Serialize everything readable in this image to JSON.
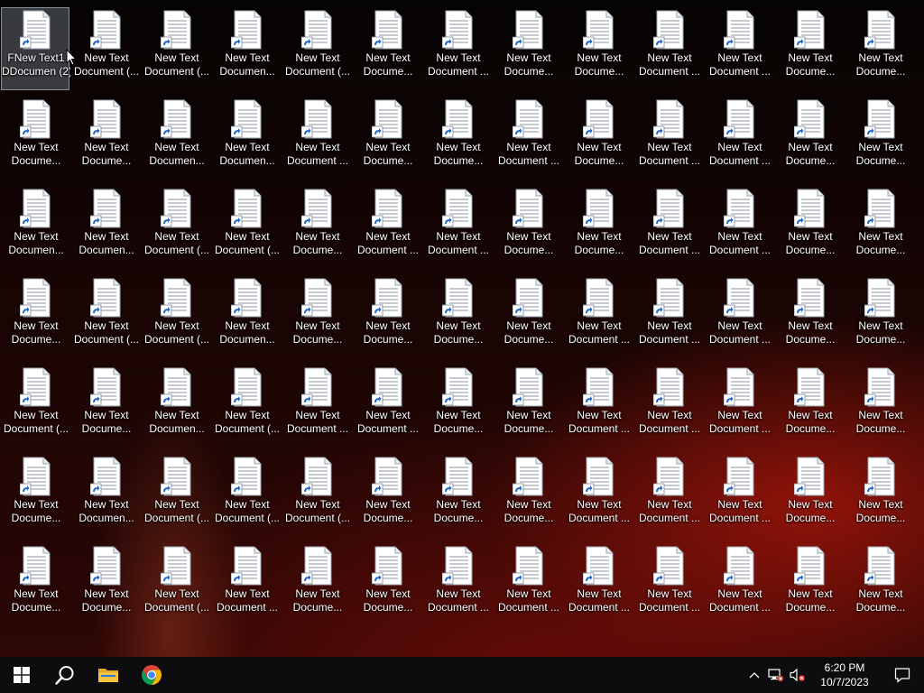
{
  "desktop": {
    "icon_rows": [
      [
        {
          "line1": "FNew Text1",
          "line2": "DDocumen (2)",
          "selected": true
        },
        {
          "line1": "New Text",
          "line2": "Document (..."
        },
        {
          "line1": "New Text",
          "line2": "Document (..."
        },
        {
          "line1": "New Text",
          "line2": "Documen..."
        },
        {
          "line1": "New Text",
          "line2": "Document (..."
        },
        {
          "line1": "New Text",
          "line2": "Docume..."
        },
        {
          "line1": "New Text",
          "line2": "Document ..."
        },
        {
          "line1": "New Text",
          "line2": "Docume..."
        },
        {
          "line1": "New Text",
          "line2": "Docume..."
        },
        {
          "line1": "New Text",
          "line2": "Document ..."
        },
        {
          "line1": "New Text",
          "line2": "Document ..."
        },
        {
          "line1": "New Text",
          "line2": "Docume..."
        },
        {
          "line1": "New Text",
          "line2": "Docume..."
        }
      ],
      [
        {
          "line1": "New Text",
          "line2": "Docume..."
        },
        {
          "line1": "New Text",
          "line2": "Docume..."
        },
        {
          "line1": "New Text",
          "line2": "Documen..."
        },
        {
          "line1": "New Text",
          "line2": "Documen..."
        },
        {
          "line1": "New Text",
          "line2": "Document ..."
        },
        {
          "line1": "New Text",
          "line2": "Docume..."
        },
        {
          "line1": "New Text",
          "line2": "Docume..."
        },
        {
          "line1": "New Text",
          "line2": "Document ..."
        },
        {
          "line1": "New Text",
          "line2": "Docume..."
        },
        {
          "line1": "New Text",
          "line2": "Document ..."
        },
        {
          "line1": "New Text",
          "line2": "Document ..."
        },
        {
          "line1": "New Text",
          "line2": "Docume..."
        },
        {
          "line1": "New Text",
          "line2": "Docume..."
        }
      ],
      [
        {
          "line1": "New Text",
          "line2": "Documen..."
        },
        {
          "line1": "New Text",
          "line2": "Documen..."
        },
        {
          "line1": "New Text",
          "line2": "Document (..."
        },
        {
          "line1": "New Text",
          "line2": "Document (..."
        },
        {
          "line1": "New Text",
          "line2": "Docume..."
        },
        {
          "line1": "New Text",
          "line2": "Document ..."
        },
        {
          "line1": "New Text",
          "line2": "Document ..."
        },
        {
          "line1": "New Text",
          "line2": "Docume..."
        },
        {
          "line1": "New Text",
          "line2": "Docume..."
        },
        {
          "line1": "New Text",
          "line2": "Document ..."
        },
        {
          "line1": "New Text",
          "line2": "Document ..."
        },
        {
          "line1": "New Text",
          "line2": "Docume..."
        },
        {
          "line1": "New Text",
          "line2": "Docume..."
        }
      ],
      [
        {
          "line1": "New Text",
          "line2": "Docume..."
        },
        {
          "line1": "New Text",
          "line2": "Document (..."
        },
        {
          "line1": "New Text",
          "line2": "Document (..."
        },
        {
          "line1": "New Text",
          "line2": "Documen..."
        },
        {
          "line1": "New Text",
          "line2": "Docume..."
        },
        {
          "line1": "New Text",
          "line2": "Docume..."
        },
        {
          "line1": "New Text",
          "line2": "Docume..."
        },
        {
          "line1": "New Text",
          "line2": "Docume..."
        },
        {
          "line1": "New Text",
          "line2": "Document ..."
        },
        {
          "line1": "New Text",
          "line2": "Document ..."
        },
        {
          "line1": "New Text",
          "line2": "Document ..."
        },
        {
          "line1": "New Text",
          "line2": "Docume..."
        },
        {
          "line1": "New Text",
          "line2": "Docume..."
        }
      ],
      [
        {
          "line1": "New Text",
          "line2": "Document (..."
        },
        {
          "line1": "New Text",
          "line2": "Docume..."
        },
        {
          "line1": "New Text",
          "line2": "Documen..."
        },
        {
          "line1": "New Text",
          "line2": "Document (..."
        },
        {
          "line1": "New Text",
          "line2": "Document ..."
        },
        {
          "line1": "New Text",
          "line2": "Document ..."
        },
        {
          "line1": "New Text",
          "line2": "Docume..."
        },
        {
          "line1": "New Text",
          "line2": "Docume..."
        },
        {
          "line1": "New Text",
          "line2": "Document ..."
        },
        {
          "line1": "New Text",
          "line2": "Document ..."
        },
        {
          "line1": "New Text",
          "line2": "Document ..."
        },
        {
          "line1": "New Text",
          "line2": "Docume..."
        },
        {
          "line1": "New Text",
          "line2": "Docume..."
        }
      ],
      [
        {
          "line1": "New Text",
          "line2": "Docume..."
        },
        {
          "line1": "New Text",
          "line2": "Documen..."
        },
        {
          "line1": "New Text",
          "line2": "Document (..."
        },
        {
          "line1": "New Text",
          "line2": "Document (..."
        },
        {
          "line1": "New Text",
          "line2": "Document (..."
        },
        {
          "line1": "New Text",
          "line2": "Docume..."
        },
        {
          "line1": "New Text",
          "line2": "Docume..."
        },
        {
          "line1": "New Text",
          "line2": "Docume..."
        },
        {
          "line1": "New Text",
          "line2": "Document ..."
        },
        {
          "line1": "New Text",
          "line2": "Document ..."
        },
        {
          "line1": "New Text",
          "line2": "Document ..."
        },
        {
          "line1": "New Text",
          "line2": "Docume..."
        },
        {
          "line1": "New Text",
          "line2": "Docume..."
        }
      ],
      [
        {
          "line1": "New Text",
          "line2": "Docume..."
        },
        {
          "line1": "New Text",
          "line2": "Docume..."
        },
        {
          "line1": "New Text",
          "line2": "Document (..."
        },
        {
          "line1": "New Text",
          "line2": "Document ..."
        },
        {
          "line1": "New Text",
          "line2": "Docume..."
        },
        {
          "line1": "New Text",
          "line2": "Docume..."
        },
        {
          "line1": "New Text",
          "line2": "Document ..."
        },
        {
          "line1": "New Text",
          "line2": "Document ..."
        },
        {
          "line1": "New Text",
          "line2": "Document ..."
        },
        {
          "line1": "New Text",
          "line2": "Document ..."
        },
        {
          "line1": "New Text",
          "line2": "Document ..."
        },
        {
          "line1": "New Text",
          "line2": "Docume..."
        },
        {
          "line1": "New Text",
          "line2": "Docume..."
        }
      ]
    ],
    "icon_type": "text-document-shortcut-icon"
  },
  "taskbar": {
    "pinned": [
      {
        "name": "start-button",
        "icon": "windows-logo-icon"
      },
      {
        "name": "search-button",
        "icon": "search-icon"
      },
      {
        "name": "file-explorer-button",
        "icon": "folder-icon"
      },
      {
        "name": "chrome-button",
        "icon": "chrome-icon"
      }
    ],
    "tray_icons": [
      "chevron-up-icon",
      "network-icon",
      "volume-muted-icon"
    ],
    "clock": {
      "time": "6:20 PM",
      "date": "10/7/2023"
    },
    "notification_icon": "action-center-icon"
  },
  "colors": {
    "taskbar": "#0d0d10",
    "accent_red": "#9a140a",
    "label_text": "#ffffff"
  }
}
